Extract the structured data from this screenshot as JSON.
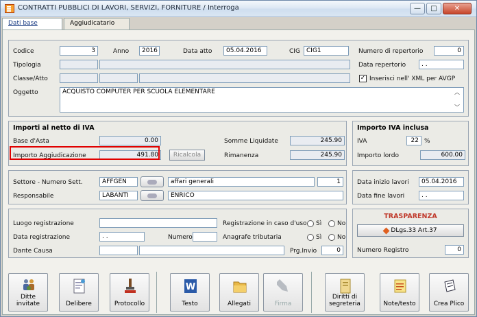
{
  "window": {
    "title": "CONTRATTI PUBBLICI DI LAVORI, SERVIZI, FORNITURE / Interroga",
    "min": "—",
    "max": "□",
    "close": "✕"
  },
  "tabs": [
    {
      "label": "Dati base"
    },
    {
      "label": "Aggiudicatario"
    }
  ],
  "general": {
    "codice_label": "Codice",
    "codice": "3",
    "anno_label": "Anno",
    "anno": "2016",
    "data_atto_label": "Data atto",
    "data_atto": "05.04.2016",
    "cig_label": "CIG",
    "cig": "CIG1",
    "tipologia_label": "Tipologia",
    "classe_label": "Classe/Atto",
    "oggetto_label": "Oggetto",
    "oggetto": "ACQUISTO COMPUTER PER SCUOLA ELEMENTARE"
  },
  "repertorio": {
    "numero_label": "Numero di repertorio",
    "numero": "0",
    "data_label": "Data repertorio",
    "data": ". .",
    "xml_label": "Inserisci nell' XML per AVGP",
    "xml_checked": "✓"
  },
  "importi": {
    "header": "Importi al netto di IVA",
    "base_label": "Base d'Asta",
    "base": "0.00",
    "aggiud_label": "Importo Aggiudicazione",
    "aggiud": "491.80",
    "ricalcola": "Ricalcola",
    "somme_label": "Somme Liquidate",
    "somme": "245.90",
    "rimanenza_label": "Rimanenza",
    "rimanenza": "245.90"
  },
  "iva": {
    "header": "Importo IVA inclusa",
    "iva_label": "IVA",
    "iva": "22",
    "percent": "%",
    "lordo_label": "Importo lordo",
    "lordo": "600.00"
  },
  "settore": {
    "label": "Settore - Numero Sett.",
    "code": "AFFGEN",
    "name": "affari generali",
    "num": "1",
    "resp_label": "Responsabile",
    "resp_code": "LABANTI",
    "resp_name": "ENRICO"
  },
  "lavori": {
    "inizio_label": "Data inizio lavori",
    "inizio": "05.04.2016",
    "fine_label": "Data fine lavori",
    "fine": ". ."
  },
  "registrazione": {
    "luogo_label": "Luogo registrazione",
    "data_label": "Data registrazione",
    "data": ". .",
    "numero_label": "Numero",
    "dante_label": "Dante Causa",
    "reg_uso_label": "Registrazione in caso d'uso",
    "si": "Sì",
    "no": "No",
    "anagrafe_label": "Anagrafe tributaria",
    "prg_label": "Prg.Invio",
    "prg": "0"
  },
  "trasparenza": {
    "header": "TRASPARENZA",
    "button": "DLgs.33 Art.37",
    "numreg_label": "Numero Registro",
    "numreg": "0"
  },
  "toolbar": [
    {
      "label": "Ditte\ninvitate",
      "icon": "people-icon"
    },
    {
      "label": "Delibere",
      "icon": "document-icon"
    },
    {
      "label": "Protocollo",
      "icon": "stamp-icon"
    },
    {
      "label": "Testo",
      "icon": "word-icon"
    },
    {
      "label": "Allegati",
      "icon": "folder-icon"
    },
    {
      "label": "Firma",
      "icon": "pen-icon"
    },
    {
      "label": "Diritti di\nsegreteria",
      "icon": "ledger-icon"
    },
    {
      "label": "Note/testo",
      "icon": "note-icon"
    },
    {
      "label": "Crea Plico",
      "icon": "archive-icon"
    }
  ],
  "colors": {
    "highlight": "#e00000",
    "trasparenza": "#c0392b",
    "title_link": "#1a3c84"
  }
}
